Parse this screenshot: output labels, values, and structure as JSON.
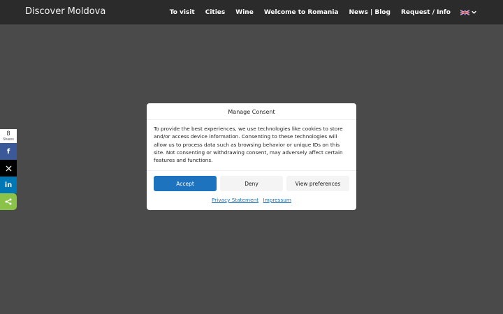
{
  "header": {
    "brand": "Discover Moldova",
    "nav": [
      "To visit",
      "Cities",
      "Wine",
      "Welcome to Romania",
      "News | Blog",
      "Request / Info"
    ],
    "language_icon": "uk-flag-icon",
    "dropdown_icon": "chevron-down-icon"
  },
  "share": {
    "count": "8",
    "count_label": "Shares",
    "buttons": [
      {
        "icon": "facebook-icon",
        "color": "#3b5998",
        "glyph": "f"
      },
      {
        "icon": "x-twitter-icon",
        "color": "#000000",
        "glyph": "𝕏"
      },
      {
        "icon": "linkedin-icon",
        "color": "#0077b5",
        "glyph": "in"
      },
      {
        "icon": "share-icon",
        "color": "#8bc34a",
        "glyph": "<"
      }
    ]
  },
  "consent": {
    "title": "Manage Consent",
    "body": "To provide the best experiences, we use technologies like cookies to store and/or access device information. Consenting to these technologies will allow us to process data such as browsing behavior or unique IDs on this site. Not consenting or withdrawing consent, may adversely affect certain features and functions.",
    "accept_label": "Accept",
    "deny_label": "Deny",
    "preferences_label": "View preferences",
    "links": [
      "Privacy Statement",
      "Impressum"
    ],
    "accent_color": "#1e73be"
  },
  "colors": {
    "backdrop": "#4a4a4a",
    "header": "#2b2b2b"
  }
}
